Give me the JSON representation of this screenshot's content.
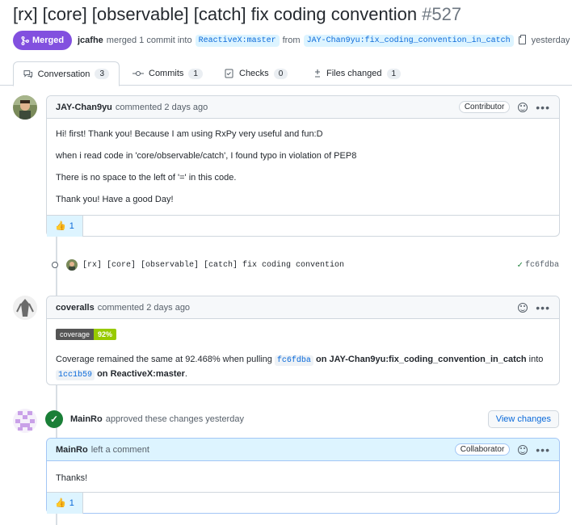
{
  "pr": {
    "title": "[rx] [core] [observable] [catch] fix coding convention",
    "number": "#527",
    "state": "Merged",
    "merger": "jcafhe",
    "merged_text": "merged 1 commit into",
    "base_branch": "ReactiveX:master",
    "from_text": "from",
    "head_branch": "JAY-Chan9yu:fix_coding_convention_in_catch",
    "when": "yesterday"
  },
  "tabs": [
    {
      "label": "Conversation",
      "count": "3",
      "icon": "comment-discussion-icon"
    },
    {
      "label": "Commits",
      "count": "1",
      "icon": "git-commit-icon"
    },
    {
      "label": "Checks",
      "count": "0",
      "icon": "checklist-icon"
    },
    {
      "label": "Files changed",
      "count": "1",
      "icon": "file-diff-icon"
    }
  ],
  "comments": [
    {
      "author": "JAY-Chan9yu",
      "action": "commented 2 days ago",
      "role": "Contributor",
      "body": [
        "Hi! first! Thank you! Because I am using RxPy very useful and fun:D",
        "when i read code in 'core/observable/catch', I found typo in violation of PEP8",
        "There is no space to the left of '=' in this code.",
        "Thank you! Have a good Day!"
      ],
      "reaction": {
        "emoji": "👍",
        "count": "1"
      }
    },
    {
      "author": "coveralls",
      "action": "commented 2 days ago",
      "badge_left": "coverage",
      "badge_right": "92%",
      "text1": "Coverage remained the same at 92.468% when pulling",
      "sha1": "fc6fdba",
      "text2": "on JAY-Chan9yu:fix_coding_convention_in_catch",
      "text3": "into",
      "sha2": "1cc1b59",
      "text4": "on ReactiveX:master",
      "text5": "."
    },
    {
      "author": "MainRo",
      "action": "left a comment",
      "role": "Collaborator",
      "body": [
        "Thanks!"
      ],
      "reaction": {
        "emoji": "👍",
        "count": "1"
      }
    }
  ],
  "commit": {
    "message": "[rx] [core] [observable] [catch] fix coding convention",
    "sha": "fc6fdba"
  },
  "review": {
    "author": "MainRo",
    "text": "approved these changes yesterday",
    "button": "View changes"
  },
  "colors": {
    "merged": "#8250df",
    "approved": "#1a7f37",
    "link": "#0969da"
  }
}
